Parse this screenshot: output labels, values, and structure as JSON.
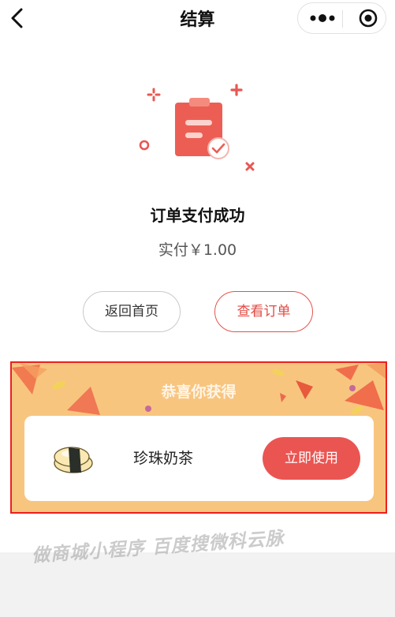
{
  "nav": {
    "title": "结算"
  },
  "status": {
    "title": "订单支付成功",
    "amount_text": "实付￥1.00"
  },
  "buttons": {
    "home": "返回首页",
    "order": "查看订单"
  },
  "reward": {
    "title": "恭喜你获得",
    "item_name": "珍珠奶茶",
    "use_label": "立即使用"
  },
  "watermark": "做商城小程序 百度搜微科云脉",
  "icons": [
    "back-arrow-icon",
    "more-dots-icon",
    "target-icon",
    "clipboard-check-icon",
    "sushi-icon"
  ],
  "colors": {
    "accent": "#e95752",
    "reward_bg": "#f8c57f",
    "highlight_border": "#ea1f1f"
  }
}
